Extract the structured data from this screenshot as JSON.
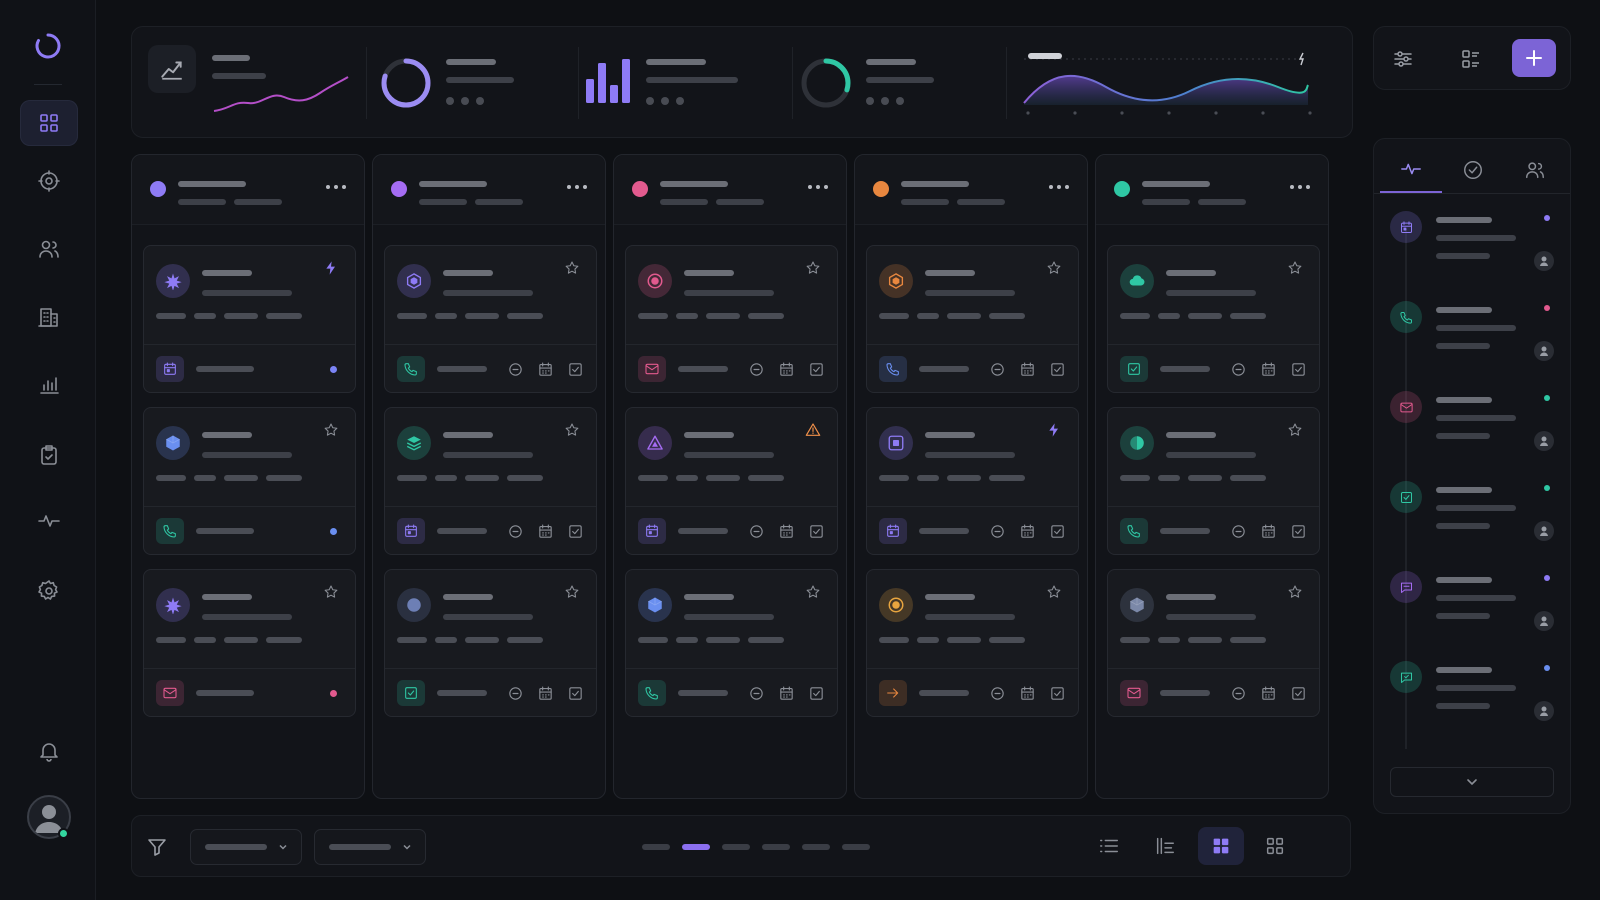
{
  "colors": {
    "accent": "#8b6ff0",
    "violet": "#8e7bf5",
    "purple": "#a56cf3",
    "pink": "#e25a8e",
    "orange": "#e8873f",
    "teal": "#2fc7a4",
    "blue": "#6a8ff0",
    "warning": "#f0904a"
  },
  "sidebar": {
    "logo_icon": "ring-logo-icon",
    "items": [
      "grid-icon",
      "target-icon",
      "users-icon",
      "building-icon",
      "bar-chart-icon",
      "clipboard-check-icon",
      "pulse-icon",
      "gear-icon"
    ],
    "active_index": 0,
    "bottom": [
      "bell-icon",
      "avatar"
    ]
  },
  "stats": [
    {
      "icon": "trend-chart-icon",
      "widget": "sparkline"
    },
    {
      "icon": "ring-icon",
      "widget": "donut",
      "progress": 0.8
    },
    {
      "icon": "bar-chart-icon",
      "widget": "bars",
      "bars": [
        0.55,
        0.9,
        0.4,
        1.0
      ]
    },
    {
      "icon": "ring-icon",
      "widget": "donut",
      "progress": 0.3
    },
    {
      "icon": "wave-chart-icon",
      "widget": "area-wave"
    }
  ],
  "toolbar": {
    "icons": [
      "sliders-icon",
      "list-detail-icon",
      "plus-icon"
    ]
  },
  "board": {
    "columns": [
      {
        "color": "#8e7bf5",
        "cards": [
          {
            "icon": "sparkle-icon",
            "tint": "#8e7bf5",
            "corner": "lightning-icon",
            "footer_icon": "calendar-icon",
            "footer_tint": "#8e7bf5",
            "footer_actions": false,
            "dot": "#7b84f5"
          },
          {
            "icon": "hexagon-icon",
            "tint": "#6a8ff0",
            "corner": "star-icon",
            "footer_icon": "phone-icon",
            "footer_tint": "#2fc7a4",
            "footer_actions": false,
            "dot": "#6a8ff0"
          },
          {
            "icon": "sparkle-icon",
            "tint": "#8e7bf5",
            "corner": "star-icon",
            "footer_icon": "mail-icon",
            "footer_tint": "#e25a8e",
            "footer_actions": false,
            "dot": "#e25a8e"
          }
        ]
      },
      {
        "color": "#a56cf3",
        "cards": [
          {
            "icon": "hex-box-icon",
            "tint": "#8e7bf5",
            "corner": "star-icon",
            "footer_icon": "phone-icon",
            "footer_tint": "#2fc7a4",
            "footer_actions": true
          },
          {
            "icon": "layers-icon",
            "tint": "#2fc7a4",
            "corner": "star-icon",
            "footer_icon": "calendar-icon",
            "footer_tint": "#8e7bf5",
            "footer_actions": true
          },
          {
            "icon": "circle-icon",
            "tint": "#6d7fb5",
            "corner": "star-icon",
            "footer_icon": "check-square-icon",
            "footer_tint": "#2fc7a4",
            "footer_actions": true
          }
        ]
      },
      {
        "color": "#e25a8e",
        "cards": [
          {
            "icon": "target-dot-icon",
            "tint": "#e25a8e",
            "corner": "star-icon",
            "footer_icon": "mail-icon",
            "footer_tint": "#e25a8e",
            "footer_actions": true
          },
          {
            "icon": "triangle-icon",
            "tint": "#a56cf3",
            "corner": "warning-icon",
            "footer_icon": "calendar-icon",
            "footer_tint": "#8e7bf5",
            "footer_actions": true
          },
          {
            "icon": "hexagon-icon",
            "tint": "#6a8ff0",
            "corner": "star-icon",
            "footer_icon": "phone-icon",
            "footer_tint": "#2fc7a4",
            "footer_actions": true
          }
        ]
      },
      {
        "color": "#e8873f",
        "cards": [
          {
            "icon": "hex-box-icon",
            "tint": "#e8873f",
            "corner": "star-icon",
            "footer_icon": "phone-icon",
            "footer_tint": "#6a8ff0",
            "footer_actions": true
          },
          {
            "icon": "square-box-icon",
            "tint": "#8e7bf5",
            "corner": "lightning-icon",
            "footer_icon": "calendar-icon",
            "footer_tint": "#8e7bf5",
            "footer_actions": true
          },
          {
            "icon": "target-dot-icon",
            "tint": "#e8a53f",
            "corner": "star-icon",
            "footer_icon": "arrow-right-icon",
            "footer_tint": "#e8873f",
            "footer_actions": true
          }
        ]
      },
      {
        "color": "#2fc7a4",
        "cards": [
          {
            "icon": "cloud-icon",
            "tint": "#2fc7a4",
            "corner": "star-icon",
            "footer_icon": "check-square-icon",
            "footer_tint": "#2fc7a4",
            "footer_actions": true
          },
          {
            "icon": "pie-icon",
            "tint": "#2fc7a4",
            "corner": "star-icon",
            "footer_icon": "phone-icon",
            "footer_tint": "#2fc7a4",
            "footer_actions": true
          },
          {
            "icon": "hexagon-icon",
            "tint": "#7b88a8",
            "corner": "star-icon",
            "footer_icon": "mail-icon",
            "footer_tint": "#e25a8e",
            "footer_actions": true
          }
        ]
      }
    ]
  },
  "right_panel": {
    "tabs": [
      "pulse-icon",
      "check-circle-icon",
      "users-icon"
    ],
    "active_tab": 0,
    "activity": [
      {
        "icon": "calendar-icon",
        "tint": "#8e7bf5",
        "dot": "#8e7bf5"
      },
      {
        "icon": "phone-icon",
        "tint": "#2fc7a4",
        "dot": "#e25a8e"
      },
      {
        "icon": "mail-icon",
        "tint": "#e25a8e",
        "dot": "#2fc7a4"
      },
      {
        "icon": "check-square-icon",
        "tint": "#2fc7a4",
        "dot": "#2fc7a4"
      },
      {
        "icon": "chat-icon",
        "tint": "#a56cf3",
        "dot": "#8e7bf5"
      },
      {
        "icon": "chat-check-icon",
        "tint": "#2fc7a4",
        "dot": "#6a8ff0"
      }
    ],
    "more_icon": "chevron-down-icon"
  },
  "footer": {
    "filter_icon": "filter-icon",
    "pages": 6,
    "active_page": 1,
    "views": [
      "list-icon",
      "timeline-icon",
      "grid-filled-icon",
      "grid-outline-icon"
    ],
    "active_view": 2
  }
}
